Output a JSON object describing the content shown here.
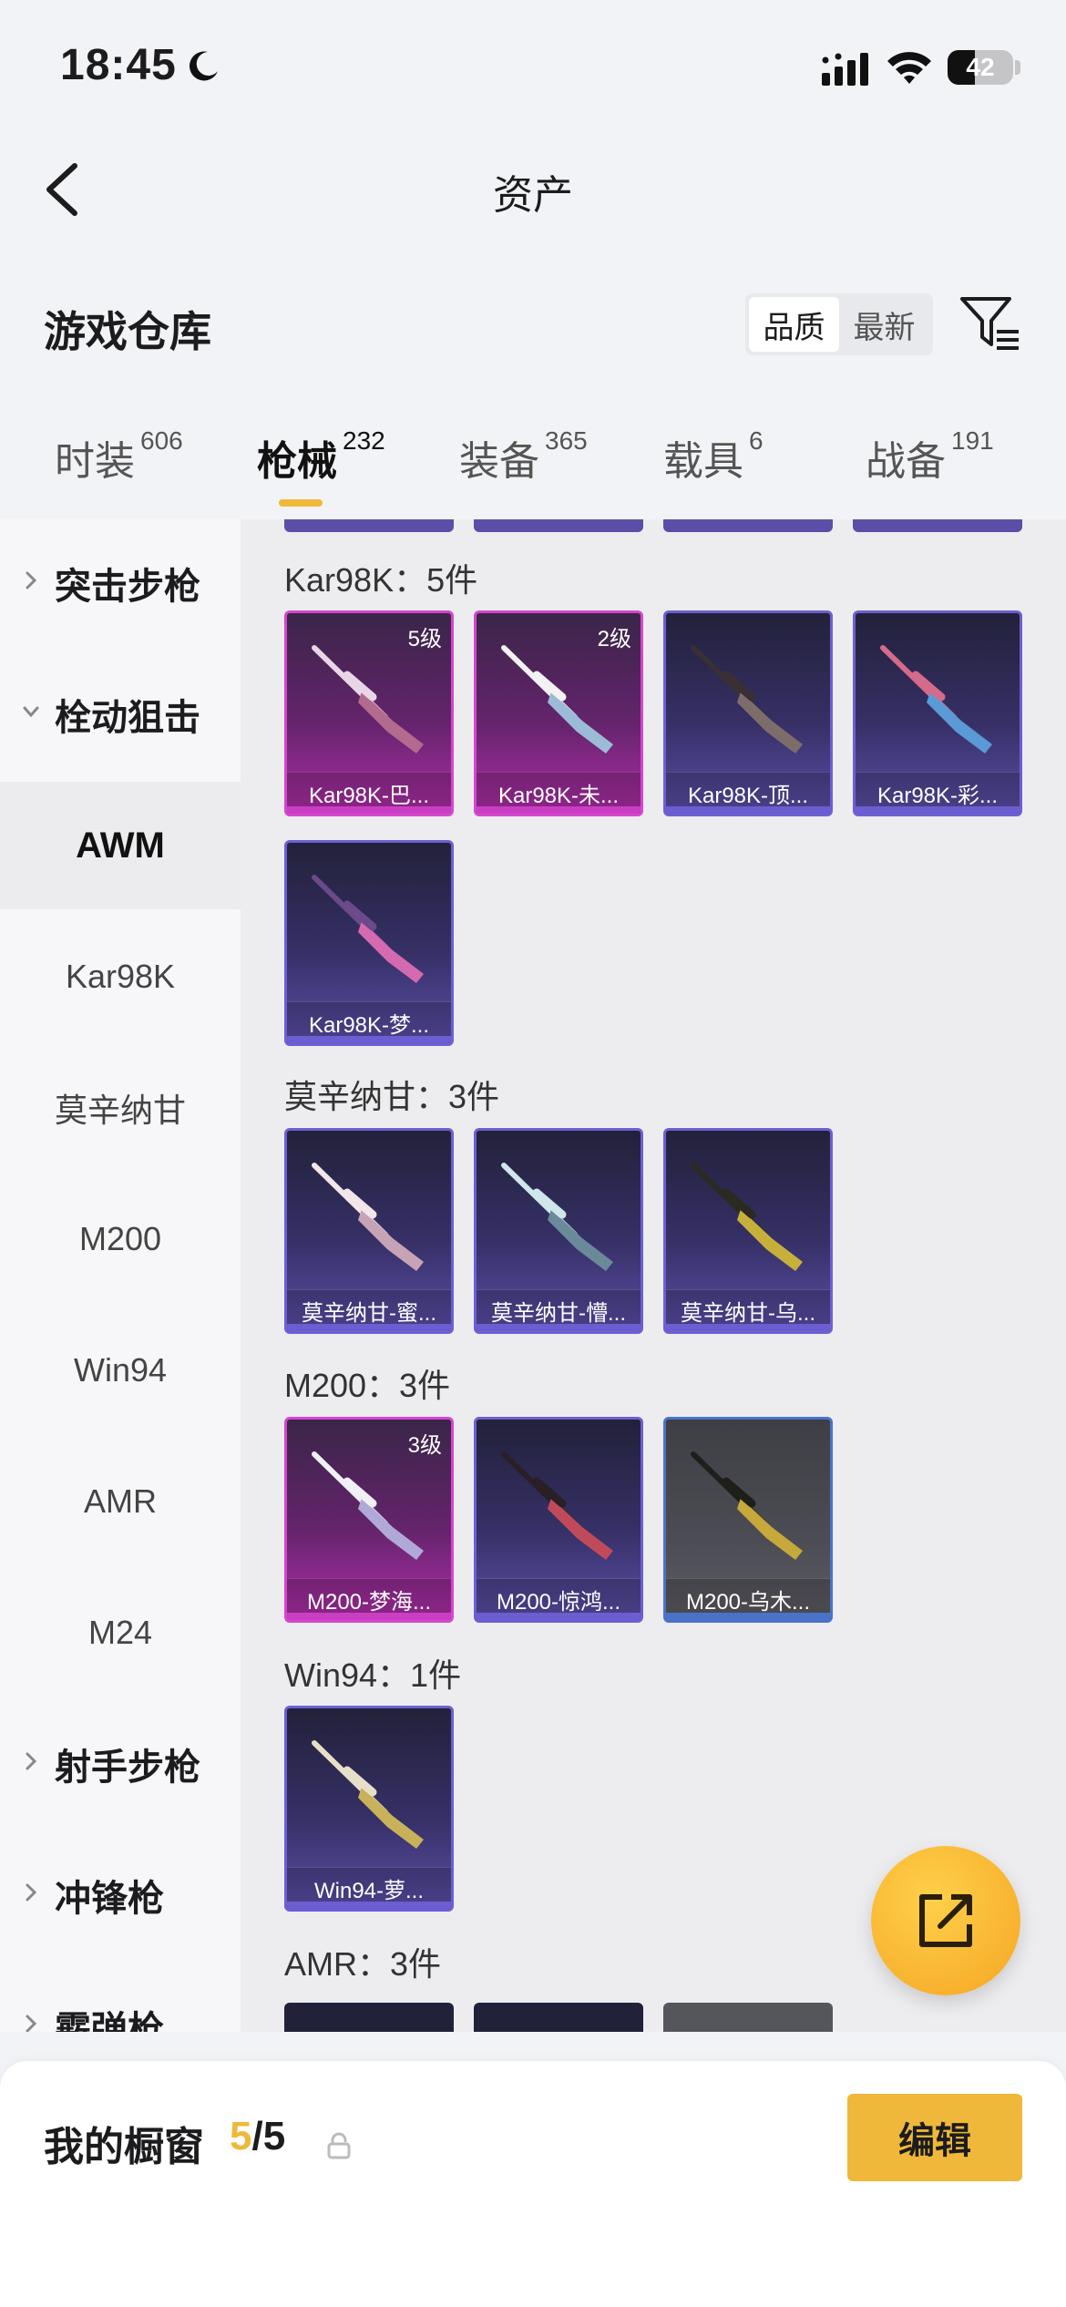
{
  "status_bar": {
    "time": "18:45",
    "battery": "42"
  },
  "nav": {
    "title": "资产"
  },
  "warehouse": {
    "title": "游戏仓库",
    "sort_options": [
      "品质",
      "最新"
    ]
  },
  "tabs": [
    {
      "label": "时装",
      "count": "606"
    },
    {
      "label": "枪械",
      "count": "232"
    },
    {
      "label": "装备",
      "count": "365"
    },
    {
      "label": "载具",
      "count": "6"
    },
    {
      "label": "战备",
      "count": "191"
    }
  ],
  "sidebar": {
    "items": [
      {
        "label": "突击步枪",
        "type": "group",
        "expanded": false
      },
      {
        "label": "栓动狙击",
        "type": "group",
        "expanded": true
      },
      {
        "label": "AWM",
        "type": "item",
        "selected": true
      },
      {
        "label": "Kar98K",
        "type": "item"
      },
      {
        "label": "莫辛纳甘",
        "type": "item"
      },
      {
        "label": "M200",
        "type": "item"
      },
      {
        "label": "Win94",
        "type": "item"
      },
      {
        "label": "AMR",
        "type": "item"
      },
      {
        "label": "M24",
        "type": "item"
      },
      {
        "label": "射手步枪",
        "type": "group",
        "expanded": false
      },
      {
        "label": "冲锋枪",
        "type": "group",
        "expanded": false
      },
      {
        "label": "霰弹枪",
        "type": "group",
        "expanded": false
      }
    ]
  },
  "groups": [
    {
      "label": "Kar98K：5件",
      "items": [
        {
          "name": "Kar98K-巴...",
          "level": "5级",
          "rarity": "purple",
          "gun": "kar-a"
        },
        {
          "name": "Kar98K-未...",
          "level": "2级",
          "rarity": "purple",
          "gun": "kar-b"
        },
        {
          "name": "Kar98K-顶...",
          "level": "",
          "rarity": "blue",
          "gun": "kar-c"
        },
        {
          "name": "Kar98K-彩...",
          "level": "",
          "rarity": "blue",
          "gun": "kar-d"
        },
        {
          "name": "Kar98K-梦...",
          "level": "",
          "rarity": "blue",
          "gun": "kar-e"
        }
      ]
    },
    {
      "label": "莫辛纳甘：3件",
      "items": [
        {
          "name": "莫辛纳甘-蜜...",
          "level": "",
          "rarity": "blue",
          "gun": "mosin-a"
        },
        {
          "name": "莫辛纳甘-懵...",
          "level": "",
          "rarity": "blue",
          "gun": "mosin-b"
        },
        {
          "name": "莫辛纳甘-乌...",
          "level": "",
          "rarity": "blue",
          "gun": "mosin-c"
        }
      ]
    },
    {
      "label": "M200：3件",
      "items": [
        {
          "name": "M200-梦海...",
          "level": "3级",
          "rarity": "purple",
          "gun": "m200-a"
        },
        {
          "name": "M200-惊鸿...",
          "level": "",
          "rarity": "blue",
          "gun": "m200-b"
        },
        {
          "name": "M200-乌木...",
          "level": "",
          "rarity": "grey",
          "gun": "m200-c"
        }
      ]
    },
    {
      "label": "Win94：1件",
      "items": [
        {
          "name": "Win94-萝...",
          "level": "",
          "rarity": "blue",
          "gun": "win94"
        }
      ]
    },
    {
      "label": "AMR：3件",
      "items": []
    }
  ],
  "showcase": {
    "title": "我的橱窗",
    "current": "5",
    "total": "/5",
    "edit_label": "编辑"
  },
  "colors": {
    "accent": "#f0b83a",
    "purple_rarity": "#d646cf",
    "blue_rarity": "#6d5fd2",
    "grey_rarity_bar": "#4a72c8"
  },
  "icons": {
    "back": "chevron-left-icon",
    "filter": "filter-icon",
    "share": "share-external-icon",
    "lock": "lock-icon"
  }
}
